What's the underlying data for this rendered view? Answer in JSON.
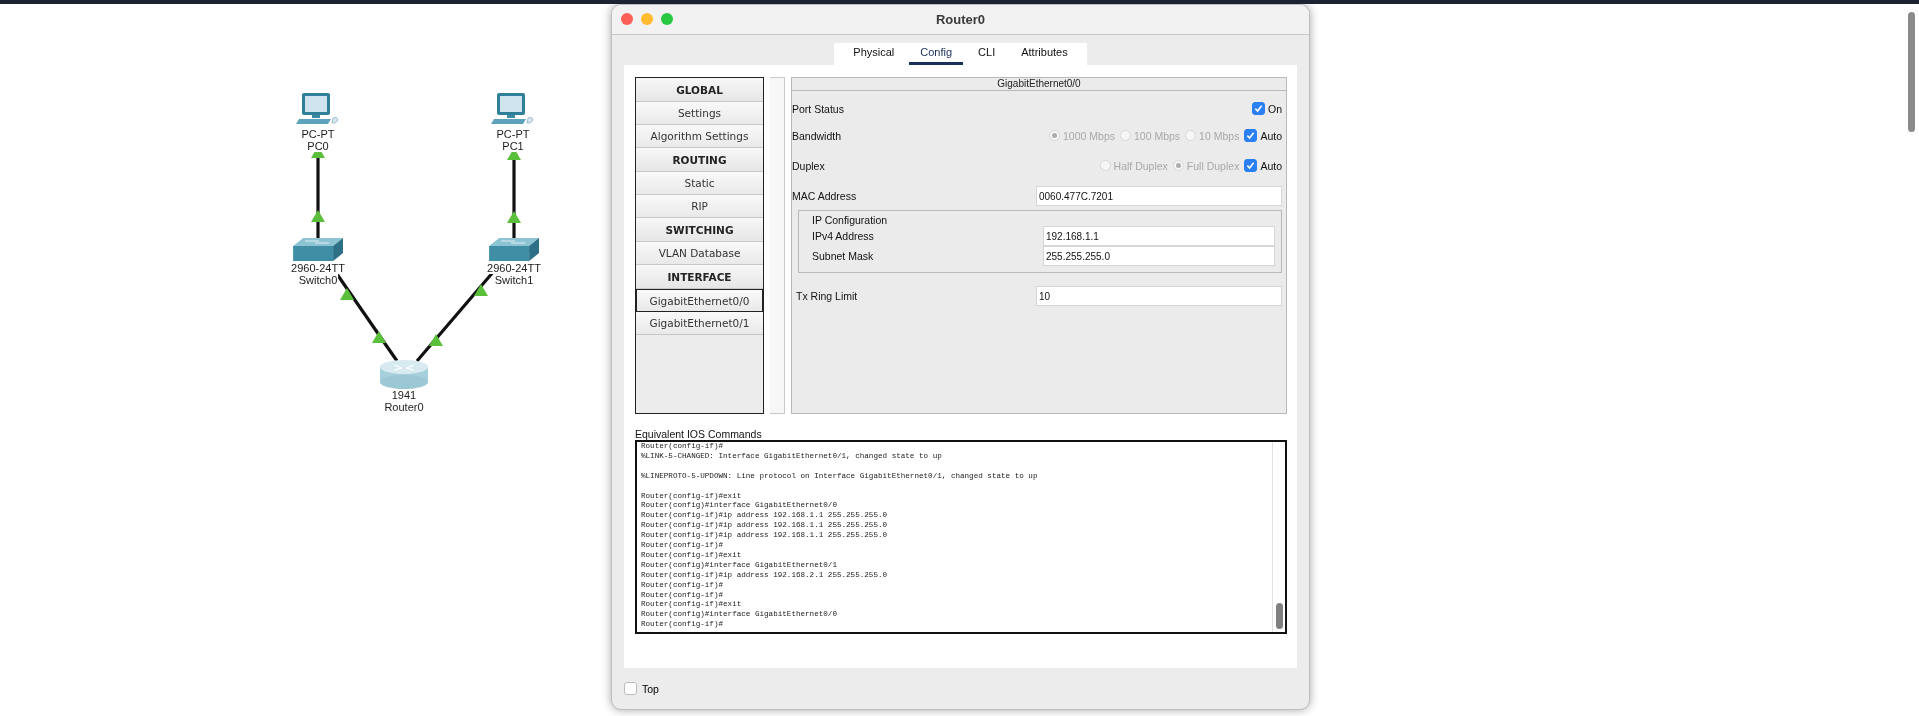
{
  "topology": {
    "devices": [
      {
        "kind": "pc",
        "model": "PC-PT",
        "name": "PC0"
      },
      {
        "kind": "pc",
        "model": "PC-PT",
        "name": "PC1"
      },
      {
        "kind": "switch",
        "model": "2960-24TT",
        "name": "Switch0"
      },
      {
        "kind": "switch",
        "model": "2960-24TT",
        "name": "Switch1"
      },
      {
        "kind": "router",
        "model": "1941",
        "name": "Router0"
      }
    ]
  },
  "window": {
    "title": "Router0"
  },
  "tabs": [
    {
      "label": "Physical",
      "selected": false
    },
    {
      "label": "Config",
      "selected": true
    },
    {
      "label": "CLI",
      "selected": false
    },
    {
      "label": "Attributes",
      "selected": false
    }
  ],
  "nav": [
    {
      "kind": "header",
      "label": "GLOBAL"
    },
    {
      "kind": "item",
      "label": "Settings",
      "selected": false
    },
    {
      "kind": "item",
      "label": "Algorithm Settings",
      "selected": false
    },
    {
      "kind": "header",
      "label": "ROUTING"
    },
    {
      "kind": "item",
      "label": "Static",
      "selected": false
    },
    {
      "kind": "item",
      "label": "RIP",
      "selected": false
    },
    {
      "kind": "header",
      "label": "SWITCHING"
    },
    {
      "kind": "item",
      "label": "VLAN Database",
      "selected": false
    },
    {
      "kind": "header",
      "label": "INTERFACE"
    },
    {
      "kind": "item",
      "label": "GigabitEthernet0/0",
      "selected": true
    },
    {
      "kind": "item",
      "label": "GigabitEthernet0/1",
      "selected": false
    }
  ],
  "panel": {
    "title": "GigabitEthernet0/0",
    "port_status": {
      "label": "Port Status",
      "option": "On",
      "checked": true
    },
    "bandwidth": {
      "label": "Bandwidth",
      "disabled": true,
      "options": [
        {
          "label": "1000 Mbps",
          "selected": true
        },
        {
          "label": "100 Mbps",
          "selected": false
        },
        {
          "label": "10 Mbps",
          "selected": false
        }
      ],
      "auto": {
        "label": "Auto",
        "checked": true
      }
    },
    "duplex": {
      "label": "Duplex",
      "disabled": true,
      "options": [
        {
          "label": "Half Duplex",
          "selected": false
        },
        {
          "label": "Full Duplex",
          "selected": true
        }
      ],
      "auto": {
        "label": "Auto",
        "checked": true
      }
    },
    "mac": {
      "label": "MAC Address",
      "value": "0060.477C.7201"
    },
    "ip_config": {
      "title": "IP Configuration",
      "fields": [
        {
          "label": "IPv4 Address",
          "value": "192.168.1.1"
        },
        {
          "label": "Subnet Mask",
          "value": "255.255.255.0"
        }
      ]
    },
    "tx_ring": {
      "label": "Tx Ring Limit",
      "value": "10"
    }
  },
  "ios": {
    "label": "Equivalent IOS Commands",
    "lines": [
      {
        "text": "Router(config-if)#"
      },
      {
        "text": "%LINK-5-CHANGED: Interface GigabitEthernet0/1, changed state to up",
        "gap_after": true
      },
      {
        "text": "%LINEPROTO-5-UPDOWN: Line protocol on Interface GigabitEthernet0/1, changed state to up",
        "gap_after": true
      },
      {
        "text": "Router(config-if)#exit"
      },
      {
        "text": "Router(config)#interface GigabitEthernet0/0"
      },
      {
        "text": "Router(config-if)#ip address 192.168.1.1 255.255.255.0"
      },
      {
        "text": "Router(config-if)#ip address 192.168.1.1 255.255.255.0"
      },
      {
        "text": "Router(config-if)#ip address 192.168.1.1 255.255.255.0"
      },
      {
        "text": "Router(config-if)#"
      },
      {
        "text": "Router(config-if)#exit"
      },
      {
        "text": "Router(config)#interface GigabitEthernet0/1"
      },
      {
        "text": "Router(config-if)#ip address 192.168.2.1 255.255.255.0"
      },
      {
        "text": "Router(config-if)#"
      },
      {
        "text": "Router(config-if)#"
      },
      {
        "text": "Router(config-if)#exit"
      },
      {
        "text": "Router(config)#interface GigabitEthernet0/0"
      },
      {
        "text": "Router(config-if)#"
      }
    ]
  },
  "top": {
    "label": "Top",
    "checked": false
  }
}
